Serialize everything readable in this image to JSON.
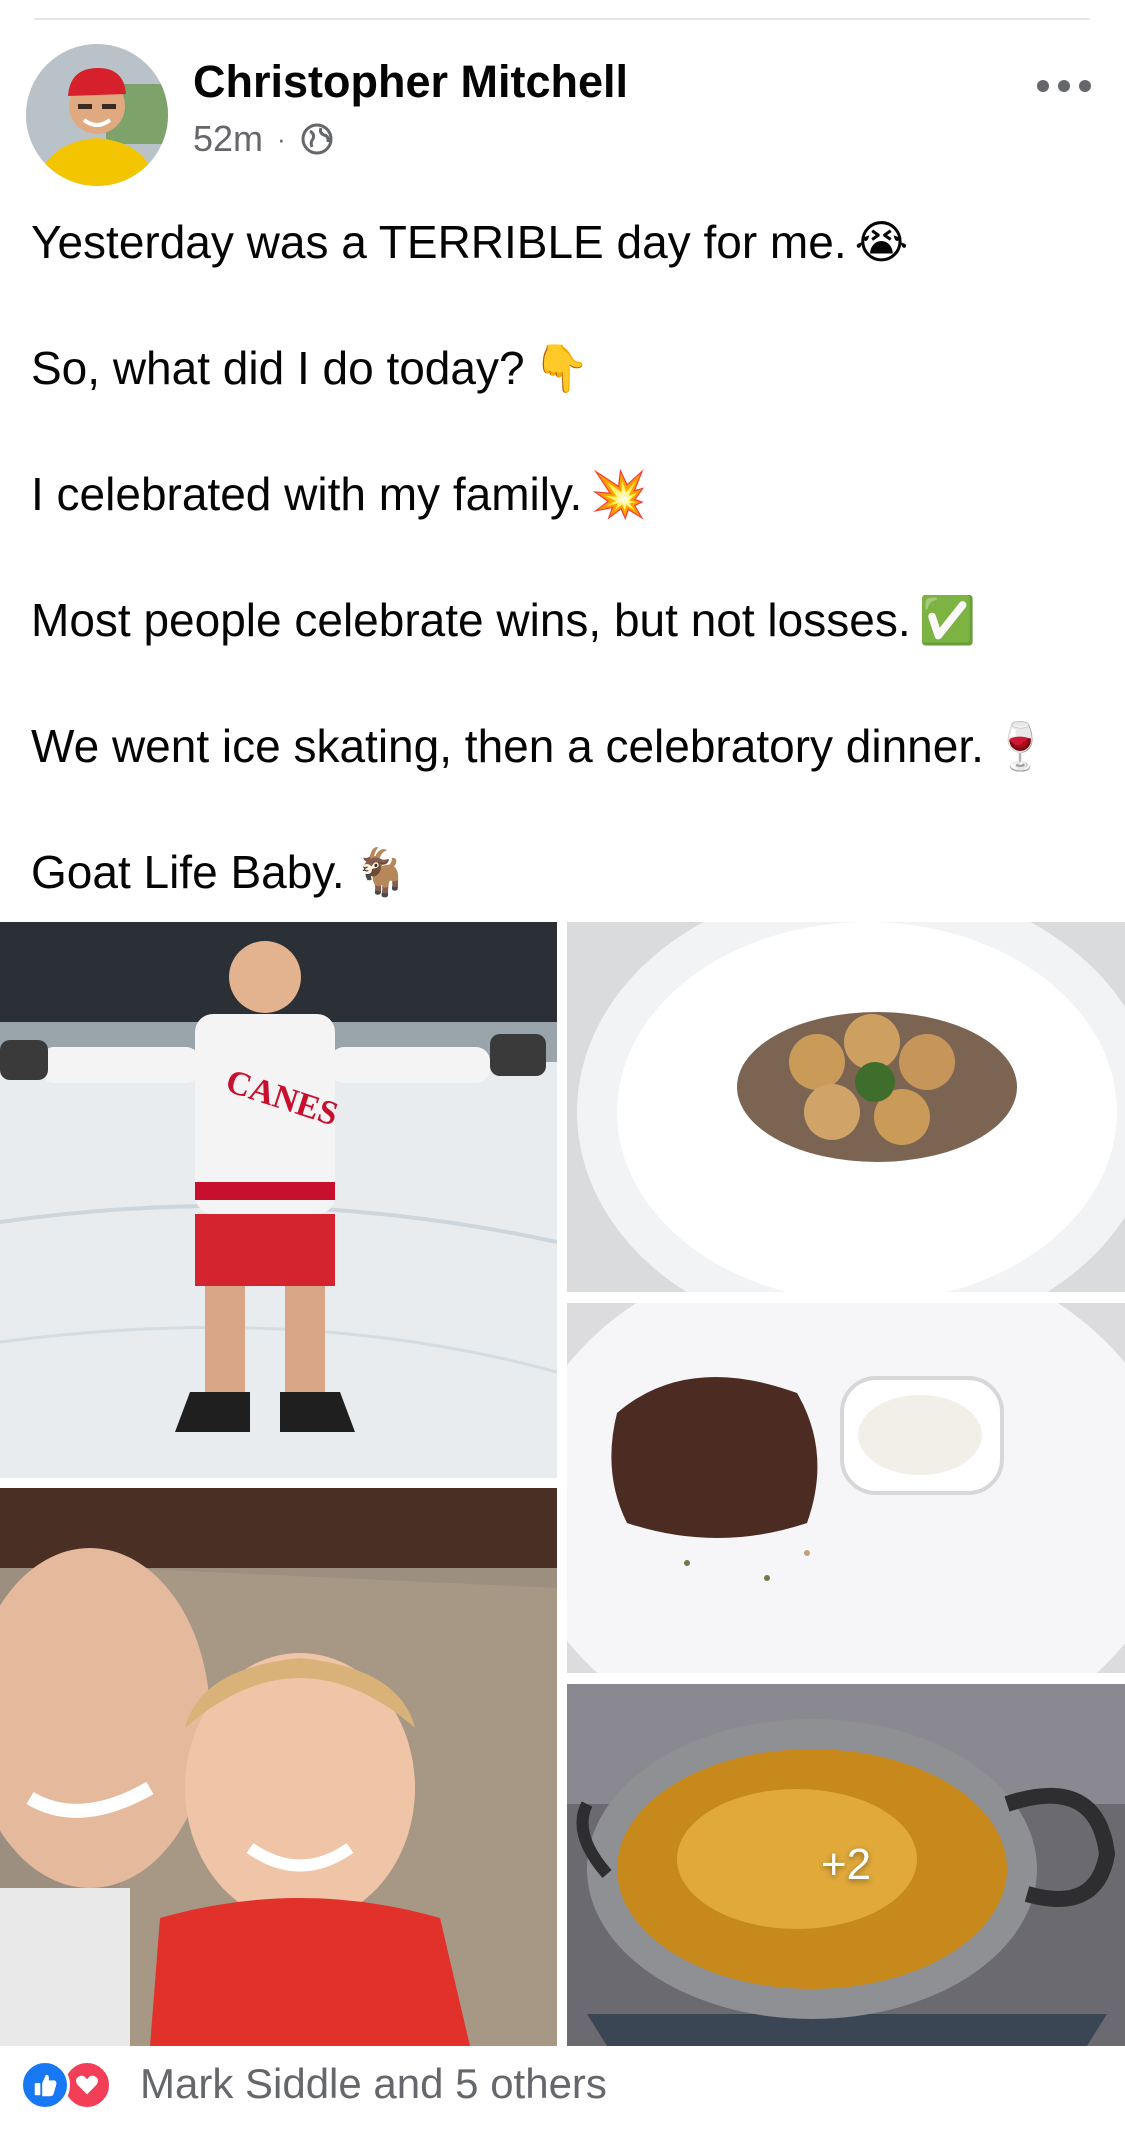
{
  "post": {
    "author": "Christopher Mitchell",
    "time": "52m",
    "separator": "·",
    "privacy_icon": "globe-icon",
    "menu_icon": "more-options-icon",
    "lines": [
      {
        "text": "Yesterday was a TERRIBLE day for me.",
        "emoji": "😭"
      },
      {
        "text": "So, what did I do today?",
        "emoji": "👇"
      },
      {
        "text": "I celebrated with my family.",
        "emoji": "💥"
      },
      {
        "text": "Most people celebrate wins, but not losses.",
        "emoji": "✅"
      },
      {
        "text": "We went ice skating, then a celebratory dinner.",
        "emoji": "🍷"
      },
      {
        "text": "Goat Life Baby.",
        "emoji": "🐐"
      }
    ]
  },
  "photos": {
    "more_count": "+2",
    "items": [
      "ice-skating-photo",
      "selfie-photo",
      "scallops-photo",
      "steak-photo",
      "mac-and-cheese-photo"
    ]
  },
  "reactions": {
    "icons": [
      "like-icon",
      "love-icon"
    ],
    "summary": "Mark Siddle and 5 others"
  },
  "colors": {
    "text": "#050505",
    "secondary": "#65676b",
    "like": "#1877f2",
    "love": "#f33e58"
  }
}
